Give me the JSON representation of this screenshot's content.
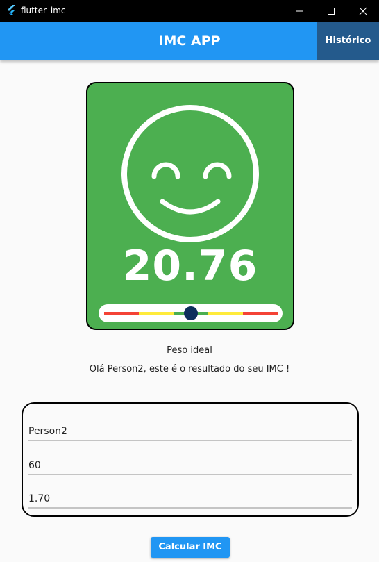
{
  "window": {
    "title": "flutter_imc",
    "app_icon": "flutter-icon",
    "controls": [
      "minimize-icon",
      "maximize-icon",
      "close-icon"
    ]
  },
  "appbar": {
    "title": "IMC APP",
    "history_button": "Histórico",
    "color": "#2196f3"
  },
  "result": {
    "imc": "20.76",
    "face_icon": "smiley-face-icon",
    "card_color": "#4caf50",
    "status": "Peso ideal",
    "greeting": "Olá Person2, este é o resultado do seu IMC !",
    "scale_colors": [
      "#f44336",
      "#ffeb3b",
      "#4caf50",
      "#ffeb3b",
      "#f44336"
    ],
    "indicator_color": "#0d2f5c"
  },
  "form": {
    "name_value": "Person2",
    "weight_value": "60",
    "height_value": "1.70"
  },
  "calculate_button": "Calcular IMC"
}
